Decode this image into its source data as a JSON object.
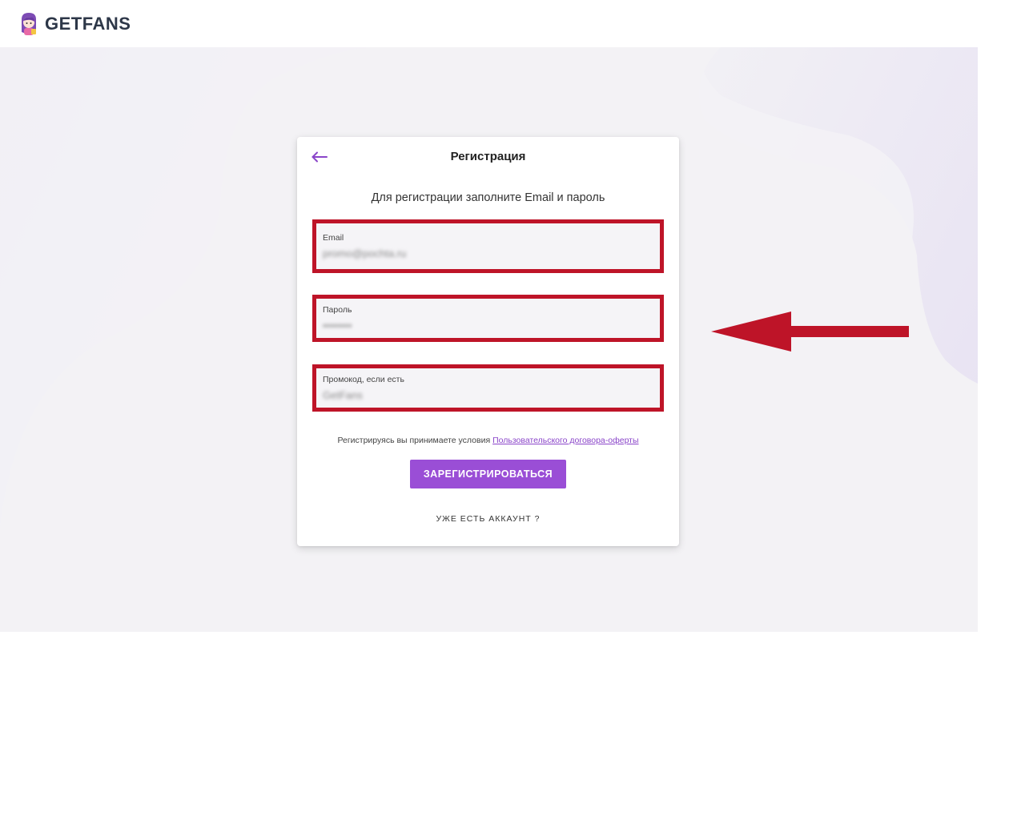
{
  "header": {
    "logo_text": "GETFANS",
    "logo_icon": "girl-avatar-icon"
  },
  "card": {
    "back_icon": "arrow-left-icon",
    "title": "Регистрация",
    "subtitle": "Для регистрации заполните Email и пароль",
    "fields": {
      "email": {
        "label": "Email",
        "value": "promo@pochta.ru"
      },
      "password": {
        "label": "Пароль",
        "value": "••••••••"
      },
      "promo": {
        "label": "Промокод, если есть",
        "value": "GetFans"
      }
    },
    "terms_prefix": "Регистрируясь вы принимаете условия",
    "terms_link": "Пользовательского договора-оферты",
    "submit_label": "ЗАРЕГИСТРИРОВАТЬСЯ",
    "login_link": "УЖЕ ЕСТЬ АККАУНТ ?"
  },
  "colors": {
    "accent": "#9a4ed6",
    "highlight": "#be1428",
    "link": "#8a45c9"
  },
  "annotation_icon": "big-red-arrow-icon"
}
